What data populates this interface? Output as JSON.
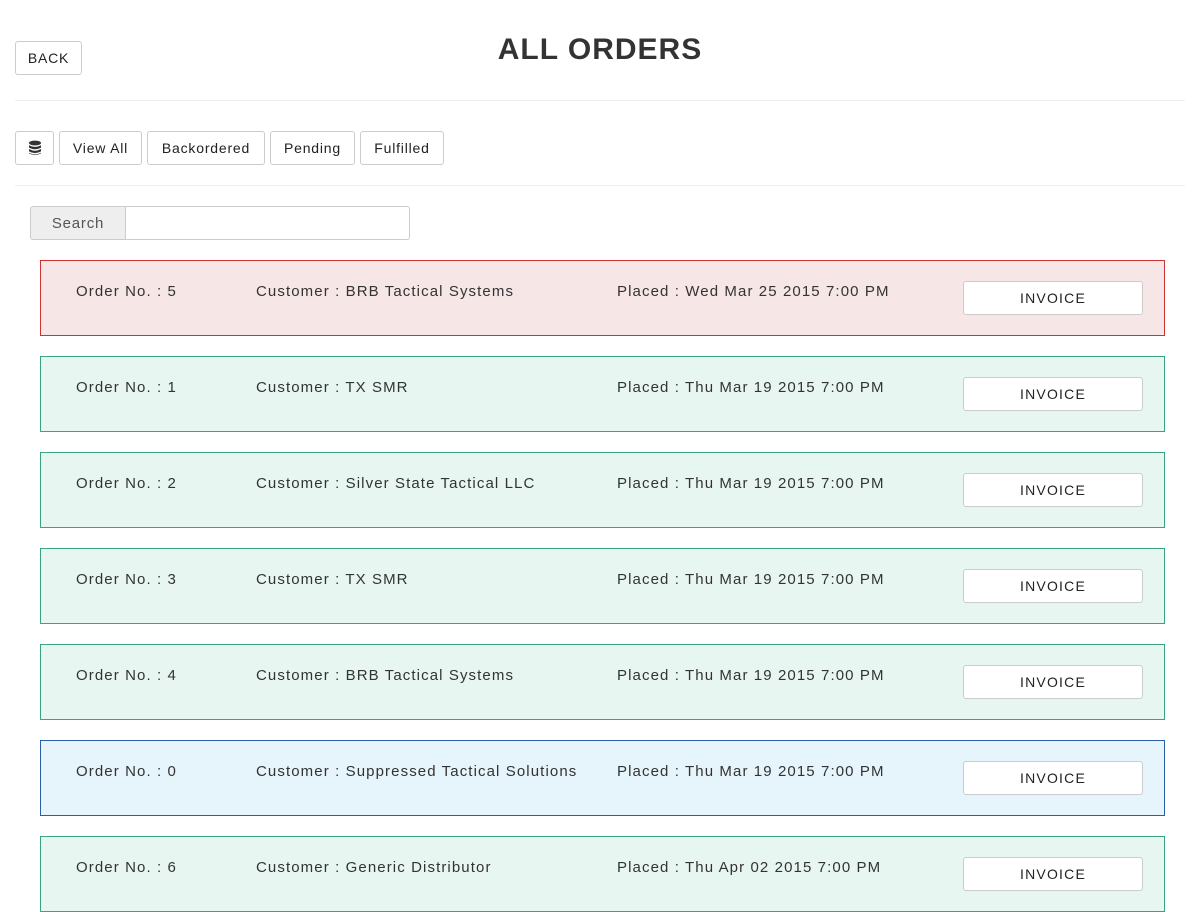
{
  "header": {
    "back_label": "BACK",
    "title": "ALL ORDERS"
  },
  "filters": {
    "db_icon": "database-icon",
    "view_all": "View All",
    "backordered": "Backordered",
    "pending": "Pending",
    "fulfilled": "Fulfilled"
  },
  "search": {
    "label": "Search",
    "value": "",
    "placeholder": ""
  },
  "status_colors": {
    "backordered": "#cc3333",
    "fulfilled": "#3aa47c",
    "pending": "#2a5fa8"
  },
  "orders": [
    {
      "order_no": "Order No. : 5",
      "customer": "Customer : BRB Tactical Systems",
      "placed": "Placed : Wed Mar 25 2015 7:00 PM",
      "status": "backordered",
      "button": "INVOICE"
    },
    {
      "order_no": "Order No. : 1",
      "customer": "Customer : TX SMR",
      "placed": "Placed : Thu Mar 19 2015 7:00 PM",
      "status": "fulfilled",
      "button": "INVOICE"
    },
    {
      "order_no": "Order No. : 2",
      "customer": "Customer : Silver State Tactical LLC",
      "placed": "Placed : Thu Mar 19 2015 7:00 PM",
      "status": "fulfilled",
      "button": "INVOICE"
    },
    {
      "order_no": "Order No. : 3",
      "customer": "Customer : TX SMR",
      "placed": "Placed : Thu Mar 19 2015 7:00 PM",
      "status": "fulfilled",
      "button": "INVOICE"
    },
    {
      "order_no": "Order No. : 4",
      "customer": "Customer : BRB Tactical Systems",
      "placed": "Placed : Thu Mar 19 2015 7:00 PM",
      "status": "fulfilled",
      "button": "INVOICE"
    },
    {
      "order_no": "Order No. : 0",
      "customer": "Customer : Suppressed Tactical Solutions",
      "placed": "Placed : Thu Mar 19 2015 7:00 PM",
      "status": "pending",
      "button": "INVOICE"
    },
    {
      "order_no": "Order No. : 6",
      "customer": "Customer : Generic Distributor",
      "placed": "Placed : Thu Apr 02 2015 7:00 PM",
      "status": "fulfilled",
      "button": "INVOICE"
    }
  ]
}
